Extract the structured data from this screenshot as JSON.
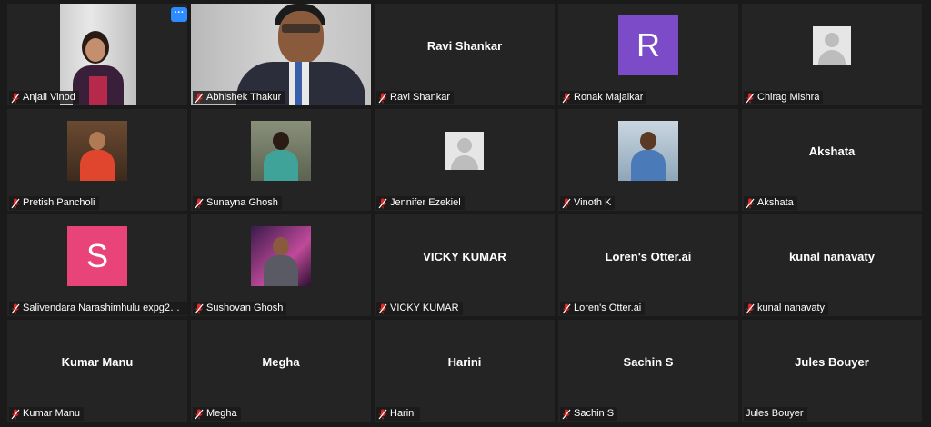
{
  "colors": {
    "background": "#1a1a1a",
    "tile": "#242424",
    "muted_mic": "#e02828",
    "more_button": "#2d8cff",
    "avatar_purple": "#7c4bc7",
    "avatar_pink": "#e8447a"
  },
  "more_button_label": "···",
  "participants": [
    {
      "name": "Anjali Vinod",
      "display": "video",
      "muted": true
    },
    {
      "name": "Abhishek Thakur",
      "display": "video",
      "muted": true
    },
    {
      "name": "Ravi Shankar",
      "display": "name",
      "center_text": "Ravi Shankar",
      "muted": true
    },
    {
      "name": "Ronak Majalkar",
      "display": "letter",
      "letter": "R",
      "muted": true
    },
    {
      "name": "Chirag Mishra",
      "display": "default-avatar",
      "muted": true
    },
    {
      "name": "Pretish Pancholi",
      "display": "photo",
      "muted": true
    },
    {
      "name": "Sunayna Ghosh",
      "display": "photo",
      "muted": true
    },
    {
      "name": "Jennifer Ezekiel",
      "display": "default-avatar",
      "muted": true
    },
    {
      "name": "Vinoth K",
      "display": "photo",
      "muted": true
    },
    {
      "name": "Akshata",
      "display": "name",
      "center_text": "Akshata",
      "muted": true
    },
    {
      "name": "Salivendara Narashimhulu expg210...",
      "display": "letter",
      "letter": "S",
      "muted": true
    },
    {
      "name": "Sushovan Ghosh",
      "display": "photo",
      "muted": true
    },
    {
      "name": "VICKY KUMAR",
      "display": "name",
      "center_text": "VICKY KUMAR",
      "muted": true
    },
    {
      "name": "Loren's Otter.ai",
      "display": "name",
      "center_text": "Loren's Otter.ai",
      "muted": true
    },
    {
      "name": "kunal nanavaty",
      "display": "name",
      "center_text": "kunal nanavaty",
      "muted": true
    },
    {
      "name": "Kumar Manu",
      "display": "name",
      "center_text": "Kumar Manu",
      "muted": true
    },
    {
      "name": "Megha",
      "display": "name",
      "center_text": "Megha",
      "muted": true
    },
    {
      "name": "Harini",
      "display": "name",
      "center_text": "Harini",
      "muted": true
    },
    {
      "name": "Sachin S",
      "display": "name",
      "center_text": "Sachin S",
      "muted": true
    },
    {
      "name": "Jules Bouyer",
      "display": "name",
      "center_text": "Jules Bouyer",
      "muted": false
    }
  ]
}
